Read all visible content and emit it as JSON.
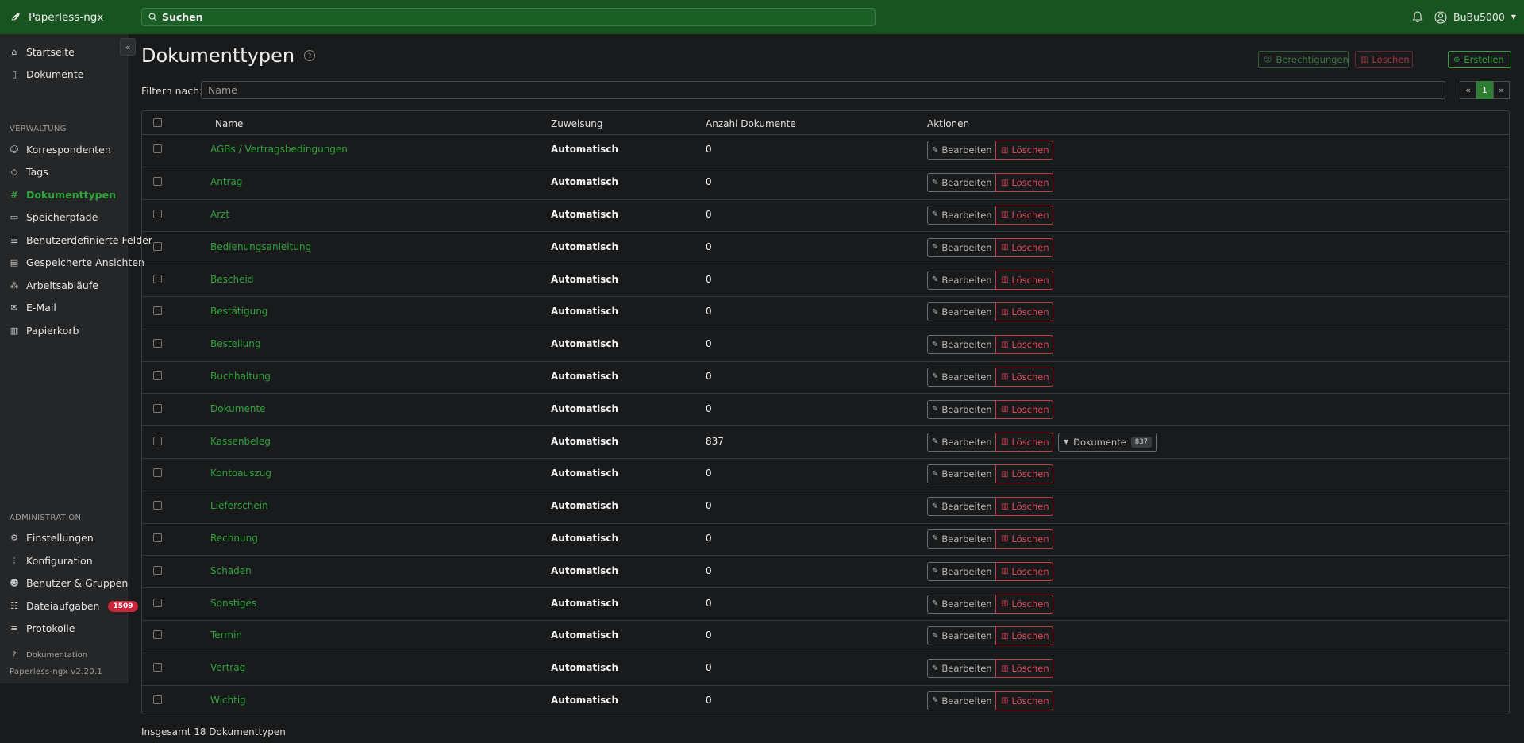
{
  "app": {
    "title": "Paperless-ngx"
  },
  "search": {
    "label": "Suchen"
  },
  "user": {
    "name": "BuBu5000"
  },
  "sidebar": {
    "items_main": [
      {
        "label": "Startseite",
        "icon": "house-icon"
      },
      {
        "label": "Dokumente",
        "icon": "files-icon"
      }
    ],
    "section_verwaltung": "VERWALTUNG",
    "items_verwaltung": [
      {
        "label": "Korrespondenten",
        "icon": "person-icon"
      },
      {
        "label": "Tags",
        "icon": "tags-icon"
      },
      {
        "label": "Dokumenttypen",
        "icon": "hash-icon",
        "active": true
      },
      {
        "label": "Speicherpfade",
        "icon": "folder-icon"
      },
      {
        "label": "Benutzerdefinierte Felder",
        "icon": "ui-radios-icon"
      },
      {
        "label": "Gespeicherte Ansichten",
        "icon": "saved-view-icon"
      },
      {
        "label": "Arbeitsabläufe",
        "icon": "workflow-icon"
      },
      {
        "label": "E-Mail",
        "icon": "envelope-icon"
      },
      {
        "label": "Papierkorb",
        "icon": "trash-icon"
      }
    ],
    "section_administration": "ADMINISTRATION",
    "items_admin": [
      {
        "label": "Einstellungen",
        "icon": "gear-icon"
      },
      {
        "label": "Konfiguration",
        "icon": "sliders-icon"
      },
      {
        "label": "Benutzer & Gruppen",
        "icon": "people-icon"
      },
      {
        "label": "Dateiaufgaben",
        "icon": "list-task-icon",
        "badge": "1509"
      },
      {
        "label": "Protokolle",
        "icon": "text-lines-icon"
      }
    ],
    "docs_link": "Dokumentation",
    "version": "Paperless-ngx v2.20.1"
  },
  "page": {
    "title": "Dokumenttypen",
    "btn_permissions": "Berechtigungen",
    "btn_delete": "Löschen",
    "btn_create": "Erstellen",
    "filter_label": "Filtern nach:",
    "filter_placeholder": "Name",
    "pager": [
      "«",
      "1",
      "»"
    ],
    "total": "Insgesamt 18 Dokumenttypen"
  },
  "table": {
    "headers": {
      "name": "Name",
      "assignment": "Zuweisung",
      "count": "Anzahl Dokumente",
      "actions": "Aktionen"
    },
    "edit_label": "Bearbeiten",
    "delete_label": "Löschen",
    "docs_label": "Dokumente",
    "rows": [
      {
        "name": "AGBs / Vertragsbedingungen",
        "assignment": "Automatisch",
        "count": "0"
      },
      {
        "name": "Antrag",
        "assignment": "Automatisch",
        "count": "0"
      },
      {
        "name": "Arzt",
        "assignment": "Automatisch",
        "count": "0"
      },
      {
        "name": "Bedienungsanleitung",
        "assignment": "Automatisch",
        "count": "0"
      },
      {
        "name": "Bescheid",
        "assignment": "Automatisch",
        "count": "0"
      },
      {
        "name": "Bestätigung",
        "assignment": "Automatisch",
        "count": "0"
      },
      {
        "name": "Bestellung",
        "assignment": "Automatisch",
        "count": "0"
      },
      {
        "name": "Buchhaltung",
        "assignment": "Automatisch",
        "count": "0"
      },
      {
        "name": "Dokumente",
        "assignment": "Automatisch",
        "count": "0"
      },
      {
        "name": "Kassenbeleg",
        "assignment": "Automatisch",
        "count": "837",
        "docs_count": "837"
      },
      {
        "name": "Kontoauszug",
        "assignment": "Automatisch",
        "count": "0"
      },
      {
        "name": "Lieferschein",
        "assignment": "Automatisch",
        "count": "0"
      },
      {
        "name": "Rechnung",
        "assignment": "Automatisch",
        "count": "0"
      },
      {
        "name": "Schaden",
        "assignment": "Automatisch",
        "count": "0"
      },
      {
        "name": "Sonstiges",
        "assignment": "Automatisch",
        "count": "0"
      },
      {
        "name": "Termin",
        "assignment": "Automatisch",
        "count": "0"
      },
      {
        "name": "Vertrag",
        "assignment": "Automatisch",
        "count": "0"
      },
      {
        "name": "Wichtig",
        "assignment": "Automatisch",
        "count": "0"
      }
    ]
  }
}
